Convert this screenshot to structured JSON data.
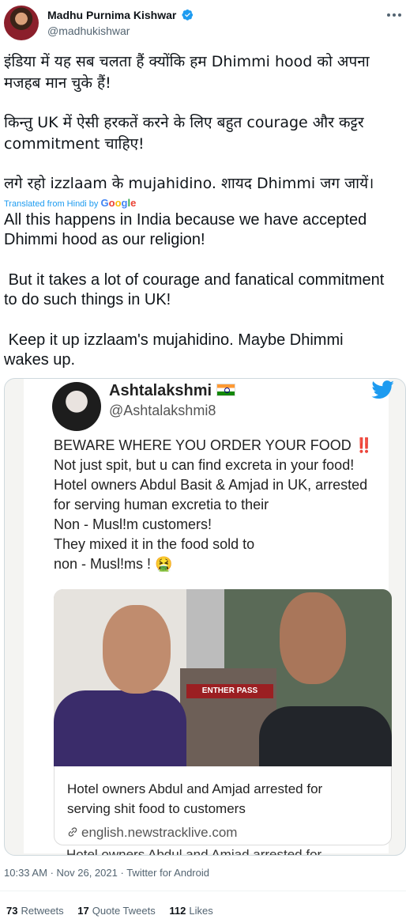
{
  "author": {
    "name": "Madhu Purnima Kishwar",
    "handle": "@madhukishwar"
  },
  "tweet": {
    "hindi_lines": [
      "इंडिया में यह  सब चलता हैं क्योंकि हम Dhimmi hood को अपना",
      "मजहब मान चुके हैं!",
      "किन्तु UK में ऐसी हरकतें करने के लिए बहुत courage और कट्टर",
      "commitment चाहिए!",
      "लगे रहो izzlaam के mujahidino. शायद Dhimmi जग जायें।"
    ],
    "translated_label": "Translated from Hindi by",
    "translation_lines": [
      "All this happens in India because we have accepted",
      "Dhimmi hood as our religion!",
      " But it takes a lot of courage and fanatical commitment",
      "to do such things in UK!",
      " Keep it up izzlaam's mujahidino. Maybe Dhimmi",
      "wakes up."
    ]
  },
  "embedded": {
    "name": "Ashtalakshmi",
    "handle": "@Ashtalakshmi8",
    "lines": [
      "BEWARE WHERE YOU ORDER YOUR FOOD ‼️",
      "Not just spit, but u can find excreta in your food!",
      "Hotel owners Abdul Basit & Amjad in UK, arrested",
      "for serving human excretia to their",
      "Non - Musl!m customers!",
      "They mixed it in the food sold to",
      "non - Musl!ms ! 🤮"
    ],
    "sign_text": "ENTHER PASS",
    "caption_lines": [
      "Hotel owners Abdul and Amjad arrested for",
      "serving shit food to customers"
    ],
    "caption_link": "english.newstracklive.com",
    "cutoff_text": "Hotel owners Abdul and Amjad arrested for"
  },
  "meta": {
    "time": "10:33 AM",
    "date": "Nov 26, 2021",
    "source": "Twitter for Android"
  },
  "stats": {
    "retweets_count": "73",
    "retweets_label": "Retweets",
    "quotes_count": "17",
    "quotes_label": "Quote Tweets",
    "likes_count": "112",
    "likes_label": "Likes"
  },
  "colors": {
    "link_blue": "#1d9bf0",
    "verified_blue": "#1d9bf0",
    "secondary_text": "#536471"
  }
}
